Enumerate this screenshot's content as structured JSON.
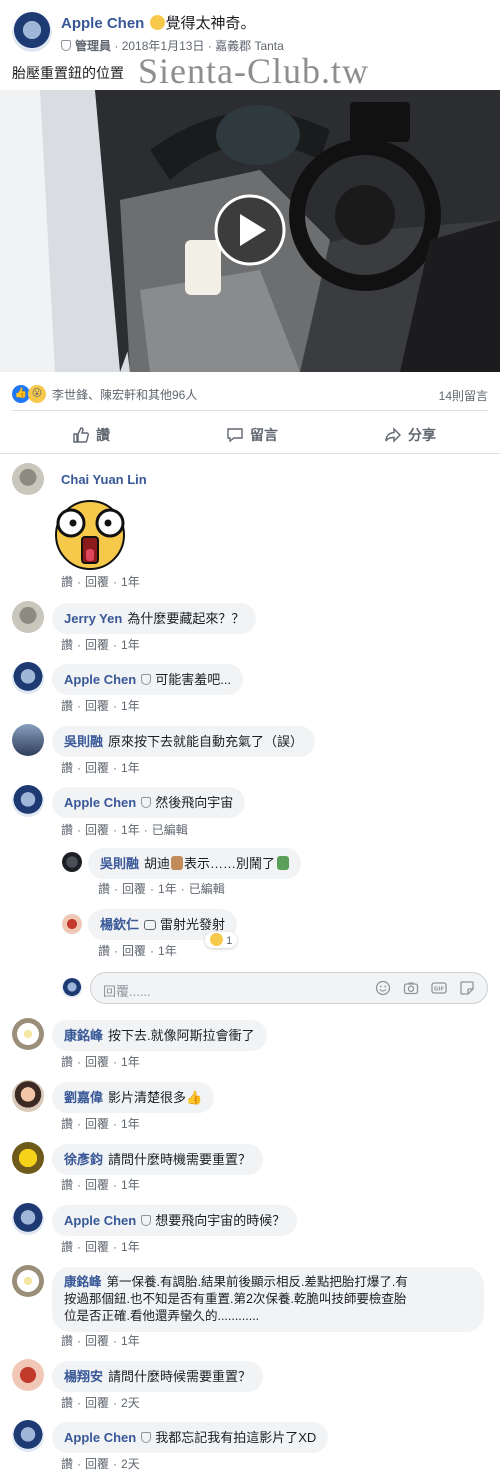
{
  "post": {
    "author": "Apple Chen",
    "feeling": "覺得太神奇。",
    "role": "管理員",
    "date": "2018年1月13日",
    "location": "嘉義郡 Tanta",
    "text": "胎壓重置鈕的位置",
    "watermark": "Sienta-Club.tw"
  },
  "reactions": {
    "names": "李世鋒、陳宏軒和其他96人",
    "comments_count": "14則留言"
  },
  "footer": {
    "like": "讚",
    "comment": "留言",
    "share": "分享"
  },
  "labels": {
    "like": "讚",
    "reply": "回覆",
    "edited": "已編輯"
  },
  "comments": [
    {
      "name": "Chai Yuan Lin",
      "text": "",
      "time": "1年"
    },
    {
      "name": "Jerry Yen",
      "text": "為什麼要藏起來？？",
      "time": "1年"
    },
    {
      "name": "Apple Chen",
      "text": "可能害羞吧...",
      "time": "1年"
    },
    {
      "name": "吳則融",
      "text": "原來按下去就能自動充氣了（誤）",
      "time": "1年"
    },
    {
      "name": "Apple Chen",
      "text": "然後飛向宇宙",
      "time": "1年"
    },
    {
      "name": "康銘峰",
      "text": "按下去.就像阿斯拉會衝了",
      "time": "1年"
    },
    {
      "name": "劉嘉偉",
      "text": "影片清楚很多👍",
      "time": "1年"
    },
    {
      "name": "徐彥鈞",
      "text": "請問什麼時機需要重置？",
      "time": "1年"
    },
    {
      "name": "Apple Chen",
      "text": "想要飛向宇宙的時候？",
      "time": "1年"
    },
    {
      "name": "康銘峰",
      "text_lines": [
        "第一保養.有調胎.結果前後顯示相反.差點把胎打爆了.有",
        "按過那個鈕.也不知是否有重置.第2次保養.乾脆叫技師要檢查胎",
        "位是否正確.看他還弄蠻久的............"
      ],
      "time": "1年"
    },
    {
      "name": "楊翔安",
      "text": "請問什麼時候需要重置？",
      "time": "2天"
    },
    {
      "name": "Apple Chen",
      "text": "我都忘記我有拍這影片了XD",
      "time": "2天"
    }
  ],
  "replies": [
    {
      "name": "吳則融",
      "text_a": "胡迪",
      "text_b": "表示……別鬧了",
      "time": "1年"
    },
    {
      "name": "楊欽仁",
      "text": "雷射光發射",
      "time": "1年",
      "reaction_count": "1"
    }
  ],
  "reply_input": {
    "placeholder": "回覆......"
  },
  "icons": [
    "like-icon",
    "wow-icon",
    "thumbs-up-icon",
    "comment-icon",
    "share-icon",
    "emoji-icon",
    "camera-icon",
    "gif-icon",
    "sticker-icon",
    "play-icon",
    "shield-icon"
  ],
  "colors": {
    "link": "#385898",
    "bubble": "#f2f3f5",
    "meta": "#606770",
    "like_blue": "#2078f4"
  }
}
